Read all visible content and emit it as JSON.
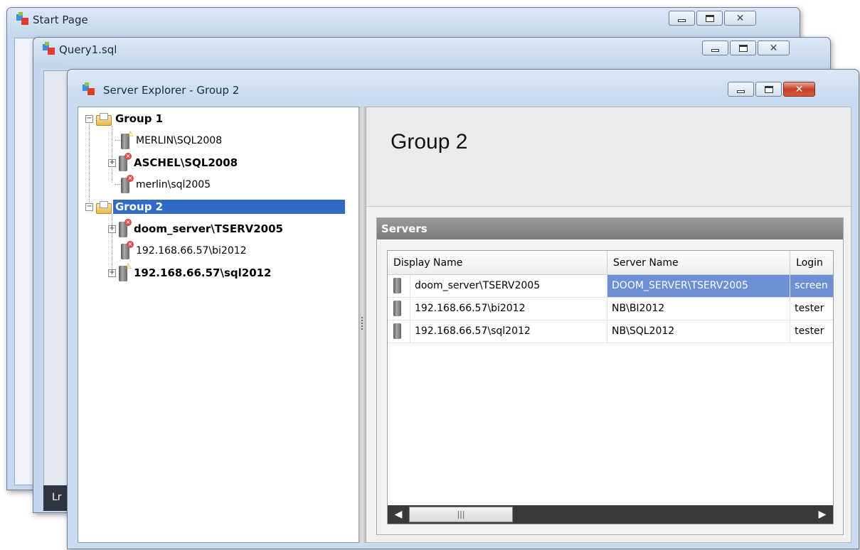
{
  "windows": {
    "start_page": {
      "title": "Start Page"
    },
    "query": {
      "title": "Query1.sql",
      "status_fragment": "Lr"
    },
    "server_explorer": {
      "title": "Server Explorer - Group 2"
    }
  },
  "tree": {
    "group1": {
      "label": "Group 1",
      "servers": [
        {
          "label": "MERLIN\\SQL2008",
          "status": "warning",
          "bold": false
        },
        {
          "label": "ASCHEL\\SQL2008",
          "status": "error",
          "bold": true
        },
        {
          "label": "merlin\\sql2005",
          "status": "error",
          "bold": false
        }
      ]
    },
    "group2": {
      "label": "Group 2",
      "servers": [
        {
          "label": "doom_server\\TSERV2005",
          "status": "error",
          "bold": true
        },
        {
          "label": "192.168.66.57\\bi2012",
          "status": "error",
          "bold": false
        },
        {
          "label": "192.168.66.57\\sql2012",
          "status": "warning",
          "bold": true
        }
      ]
    }
  },
  "detail": {
    "title": "Group 2",
    "servers_caption": "Servers",
    "columns": [
      "Display Name",
      "Server Name",
      "Login"
    ],
    "rows": [
      {
        "display": "doom_server\\TSERV2005",
        "server": "DOOM_SERVER\\TSERV2005",
        "login": "screen"
      },
      {
        "display": "192.168.66.57\\bi2012",
        "server": "NB\\BI2012",
        "login": "tester"
      },
      {
        "display": "192.168.66.57\\sql2012",
        "server": "NB\\SQL2012",
        "login": "tester"
      }
    ]
  },
  "colors": {
    "selection": "#3169c6",
    "cell_selection": "#6d8fd6",
    "close_button": "#c44028"
  }
}
